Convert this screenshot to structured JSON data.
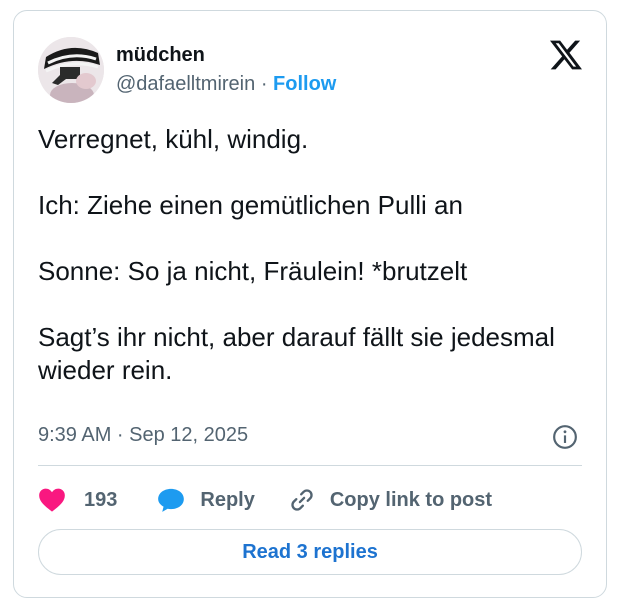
{
  "author": {
    "name": "müdchen",
    "handle": "@dafaelltmirein",
    "separator": "·",
    "follow_label": "Follow"
  },
  "tweet": {
    "paragraphs": [
      "Verregnet, kühl, windig.",
      "Ich: Ziehe einen gemütlichen Pulli an",
      "Sonne: So ja nicht, Fräulein! *brutzelt",
      "Sagt’s ihr nicht, aber darauf fällt sie jedesmal wieder rein."
    ],
    "timestamp": "9:39 AM · Sep 12, 2025"
  },
  "actions": {
    "like_count": "193",
    "reply_label": "Reply",
    "copy_label": "Copy link to post"
  },
  "footer": {
    "read_replies_label": "Read 3 replies"
  },
  "colors": {
    "accent": "#1d9bf0",
    "like": "#f91880",
    "muted": "#536471",
    "border": "#cfd9de"
  },
  "icons": [
    "x-logo-icon",
    "info-icon",
    "heart-icon",
    "reply-bubble-icon",
    "link-icon"
  ]
}
